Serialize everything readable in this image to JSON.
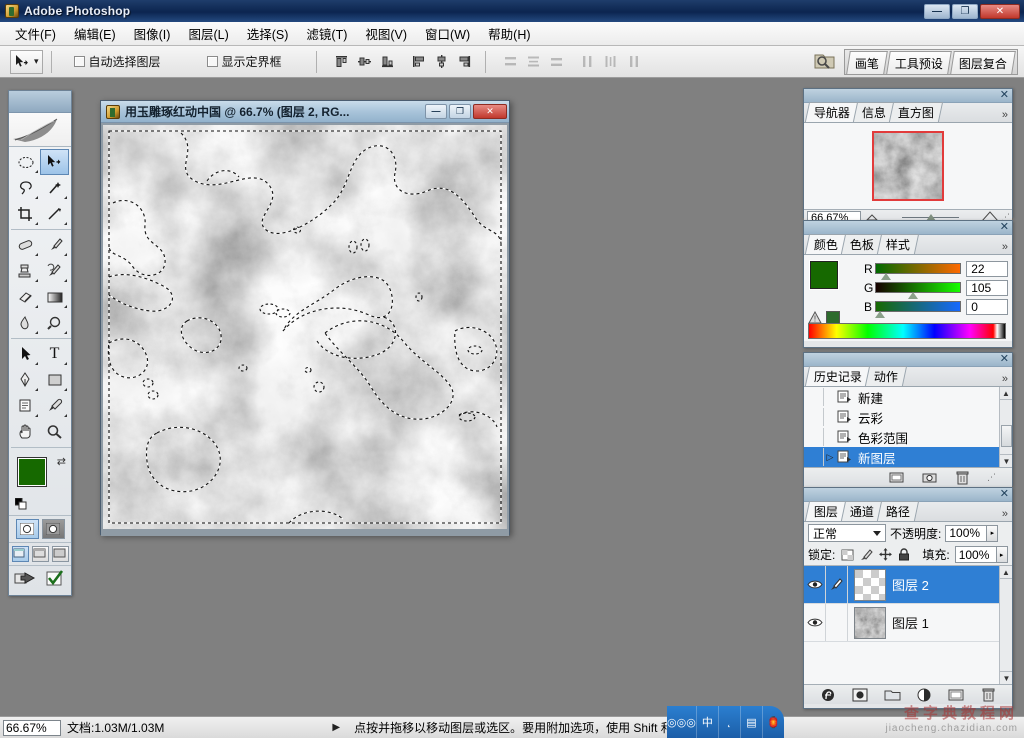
{
  "app": {
    "title": "Adobe Photoshop",
    "logo_icon": "photoshop-logo-icon",
    "window_controls": [
      {
        "name": "minimize",
        "glyph": "—"
      },
      {
        "name": "maximize",
        "glyph": "❐"
      },
      {
        "name": "close",
        "glyph": "✕"
      }
    ]
  },
  "menubar": {
    "items": [
      {
        "label": "文件(F)"
      },
      {
        "label": "编辑(E)"
      },
      {
        "label": "图像(I)"
      },
      {
        "label": "图层(L)"
      },
      {
        "label": "选择(S)"
      },
      {
        "label": "滤镜(T)"
      },
      {
        "label": "视图(V)"
      },
      {
        "label": "窗口(W)"
      },
      {
        "label": "帮助(H)"
      }
    ]
  },
  "options_bar": {
    "tool_icon": "move-tool-icon",
    "tool_preset_caret": "▾",
    "checkboxes": [
      {
        "label": "自动选择图层",
        "checked": false
      },
      {
        "label": "显示定界框",
        "checked": false
      }
    ],
    "align_buttons": [
      {
        "name": "align-top-edges",
        "dim": false
      },
      {
        "name": "align-vertical-centers",
        "dim": false
      },
      {
        "name": "align-bottom-edges",
        "dim": false
      },
      {
        "name": "align-left-edges",
        "dim": false
      },
      {
        "name": "align-horizontal-centers",
        "dim": false
      },
      {
        "name": "align-right-edges",
        "dim": false
      }
    ],
    "distribute_buttons": [
      {
        "name": "distribute-top-edges",
        "dim": true
      },
      {
        "name": "distribute-vertical-centers",
        "dim": true
      },
      {
        "name": "distribute-bottom-edges",
        "dim": true
      },
      {
        "name": "distribute-left-edges",
        "dim": true
      },
      {
        "name": "distribute-horizontal-centers",
        "dim": true
      },
      {
        "name": "distribute-right-edges",
        "dim": true
      }
    ],
    "palette_well": {
      "icon": "file-browser-icon",
      "tabs": [
        "画笔",
        "工具预设",
        "图层复合"
      ]
    }
  },
  "toolbox": {
    "tools": [
      {
        "name": "elliptical-marquee-tool",
        "glyph": "◯",
        "selected": false
      },
      {
        "name": "move-tool",
        "glyph": "✥",
        "selected": true
      },
      {
        "name": "lasso-tool",
        "glyph": "◠",
        "selected": false
      },
      {
        "name": "magic-wand-tool",
        "glyph": "✳",
        "selected": false
      },
      {
        "name": "crop-tool",
        "glyph": "⌗",
        "selected": false
      },
      {
        "name": "slice-tool",
        "glyph": "✂",
        "selected": false
      },
      {
        "name": "healing-brush-tool",
        "glyph": "▭",
        "selected": false
      },
      {
        "name": "brush-tool",
        "glyph": "✏",
        "selected": false
      },
      {
        "name": "clone-stamp-tool",
        "glyph": "⚲",
        "selected": false
      },
      {
        "name": "history-brush-tool",
        "glyph": "❧",
        "selected": false
      },
      {
        "name": "eraser-tool",
        "glyph": "▱",
        "selected": false
      },
      {
        "name": "gradient-tool",
        "glyph": "▤",
        "selected": false
      },
      {
        "name": "blur-tool",
        "glyph": "💧",
        "selected": false
      },
      {
        "name": "dodge-tool",
        "glyph": "◑",
        "selected": false
      },
      {
        "name": "path-selection-tool",
        "glyph": "➤",
        "selected": false
      },
      {
        "name": "type-tool",
        "glyph": "T",
        "selected": false
      },
      {
        "name": "pen-tool",
        "glyph": "✒",
        "selected": false
      },
      {
        "name": "rectangle-tool",
        "glyph": "▣",
        "selected": false
      },
      {
        "name": "notes-tool",
        "glyph": "▤",
        "selected": false
      },
      {
        "name": "eyedropper-tool",
        "glyph": "⌾",
        "selected": false
      },
      {
        "name": "hand-tool",
        "glyph": "✋",
        "selected": false
      },
      {
        "name": "zoom-tool",
        "glyph": "🔍",
        "selected": false
      }
    ],
    "foreground_color": "#166900",
    "background_color": "#ffffff",
    "swap_icon": "swap-colors-icon",
    "default_icon": "default-colors-icon",
    "mode_buttons": [
      {
        "name": "standard-mask-mode",
        "selected": true
      },
      {
        "name": "quick-mask-mode",
        "selected": false
      }
    ],
    "screen_buttons": [
      {
        "name": "standard-screen-mode",
        "selected": true
      },
      {
        "name": "full-screen-with-menubar",
        "selected": false
      },
      {
        "name": "full-screen-mode",
        "selected": false
      }
    ],
    "jump_buttons": [
      {
        "name": "jump-to-imageready-icon"
      },
      {
        "name": "check-icon"
      }
    ]
  },
  "document": {
    "icon": "document-icon",
    "title": "用玉雕琢红动中国 @ 66.7% (图层 2, RG...",
    "buttons": [
      {
        "name": "minimize",
        "glyph": "—"
      },
      {
        "name": "restore",
        "glyph": "❐"
      },
      {
        "name": "close",
        "glyph": "✕"
      }
    ]
  },
  "navigator": {
    "close_glyph": "✕",
    "tabs": [
      {
        "label": "导航器",
        "active": true
      },
      {
        "label": "信息",
        "active": false
      },
      {
        "label": "直方图",
        "active": false
      }
    ],
    "more_glyph": "»",
    "zoom_value": "66.67%",
    "zoom_out_icon": "zoom-out-icon",
    "zoom_in_icon": "zoom-in-icon"
  },
  "color_panel": {
    "close_glyph": "✕",
    "tabs": [
      {
        "label": "颜色",
        "active": true
      },
      {
        "label": "色板",
        "active": false
      },
      {
        "label": "样式",
        "active": false
      }
    ],
    "more_glyph": "»",
    "foreground_color": "#166900",
    "background_color": "#ffffff",
    "channels": [
      {
        "label": "R",
        "value": "22",
        "pos_pct": 9
      },
      {
        "label": "G",
        "value": "105",
        "pos_pct": 41
      },
      {
        "label": "B",
        "value": "0",
        "pos_pct": 0
      }
    ],
    "out_of_gamut_warning_icon": "gamut-warning-icon",
    "out_of_gamut_color": "#2d6b2d"
  },
  "history_panel": {
    "close_glyph": "✕",
    "tabs": [
      {
        "label": "历史记录",
        "active": true
      },
      {
        "label": "动作",
        "active": false
      }
    ],
    "more_glyph": "»",
    "items": [
      {
        "label": "新建",
        "selected": false,
        "current": false
      },
      {
        "label": "云彩",
        "selected": false,
        "current": false
      },
      {
        "label": "色彩范围",
        "selected": false,
        "current": false
      },
      {
        "label": "新图层",
        "selected": true,
        "current": true
      }
    ],
    "footer_buttons": [
      {
        "name": "create-document-from-state-icon",
        "glyph": "▭"
      },
      {
        "name": "create-new-snapshot-icon",
        "glyph": "▣"
      },
      {
        "name": "delete-state-icon",
        "glyph": "🗑"
      }
    ]
  },
  "layers_panel": {
    "close_glyph": "✕",
    "tabs": [
      {
        "label": "图层",
        "active": true
      },
      {
        "label": "通道",
        "active": false
      },
      {
        "label": "路径",
        "active": false
      }
    ],
    "more_glyph": "»",
    "blend_mode": "正常",
    "opacity_label": "不透明度:",
    "opacity_value": "100%",
    "lock_label": "锁定:",
    "lock_icons": [
      {
        "name": "lock-transparent-pixels-icon"
      },
      {
        "name": "lock-image-pixels-icon"
      },
      {
        "name": "lock-position-icon"
      },
      {
        "name": "lock-all-icon"
      }
    ],
    "fill_label": "填充:",
    "fill_value": "100%",
    "layers": [
      {
        "name": "图层 2",
        "selected": true,
        "visible": true,
        "thumb": "transparent",
        "has_brush": true
      },
      {
        "name": "图层 1",
        "selected": false,
        "visible": true,
        "thumb": "clouds",
        "has_brush": false
      }
    ],
    "footer_buttons": [
      {
        "name": "layer-style-icon",
        "glyph": "ƒ"
      },
      {
        "name": "layer-mask-icon",
        "glyph": "◍"
      },
      {
        "name": "new-group-icon",
        "glyph": "🗀"
      },
      {
        "name": "adjustment-layer-icon",
        "glyph": "◐"
      },
      {
        "name": "new-layer-icon",
        "glyph": "▭"
      },
      {
        "name": "delete-layer-icon",
        "glyph": "🗑"
      }
    ]
  },
  "status_bar": {
    "zoom": "66.67%",
    "doc_info": "文档:1.03M/1.03M",
    "play_glyph": "▶",
    "hint": "点按并拖移以移动图层或选区。要用附加选项，使用 Shift 和 Alt 键。"
  },
  "taskbar": {
    "ime_cells": [
      {
        "name": "ime-logo-icon",
        "glyph": "◎◎◎"
      },
      {
        "name": "ime-chinese-icon",
        "glyph": "中"
      },
      {
        "name": "ime-punctuation-icon",
        "glyph": "˛"
      },
      {
        "name": "ime-keyboard-icon",
        "glyph": "▤"
      },
      {
        "name": "ime-toolbox-icon",
        "glyph": "🏮"
      }
    ]
  },
  "watermark": {
    "line1": "查字典教程网",
    "line2": "jiaocheng.chazidian.com"
  },
  "canvas": {
    "zoom_percent": "66.7%",
    "render": "clouds-grayscale",
    "selection": "marching-ants"
  }
}
